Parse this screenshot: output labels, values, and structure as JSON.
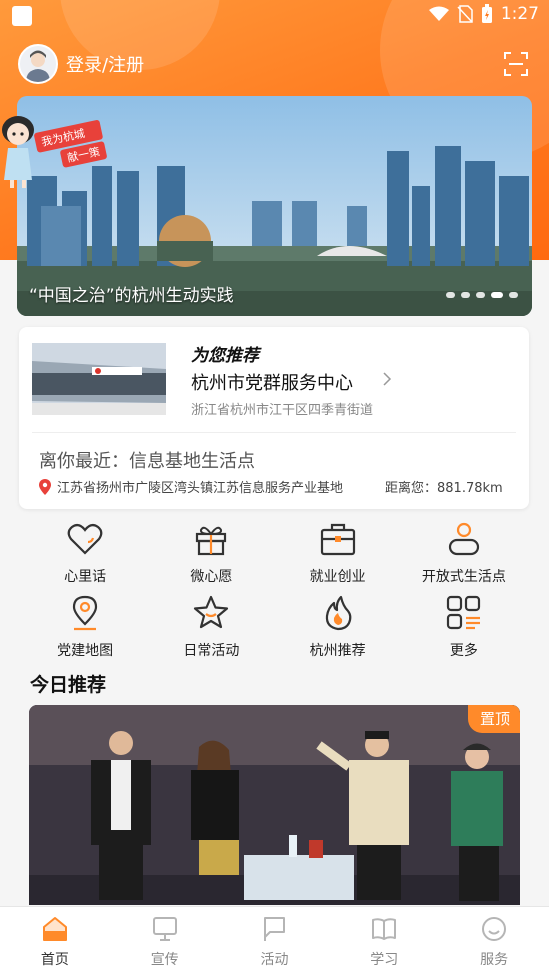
{
  "status_bar": {
    "time": "1:27"
  },
  "header": {
    "login_label": "登录/注册"
  },
  "banner": {
    "caption": "“中国之治”的杭州生动实践",
    "badge_line1": "我为杭城",
    "badge_line2": "献一策"
  },
  "recommend": {
    "heading": "为您推荐",
    "name": "杭州市党群服务中心",
    "address": "浙江省杭州市江干区四季青街道",
    "nearest_title": "离你最近：信息基地生活点",
    "nearest_address": "江苏省扬州市广陵区湾头镇江苏信息服务产业基地",
    "nearest_distance": "距离您：881.78km"
  },
  "menu": [
    {
      "label": "心里话",
      "icon": "heart-chat-icon"
    },
    {
      "label": "微心愿",
      "icon": "gift-icon"
    },
    {
      "label": "就业创业",
      "icon": "briefcase-icon"
    },
    {
      "label": "开放式生活点",
      "icon": "person-icon"
    },
    {
      "label": "党建地图",
      "icon": "map-pin-icon"
    },
    {
      "label": "日常活动",
      "icon": "star-icon"
    },
    {
      "label": "杭州推荐",
      "icon": "flame-icon"
    },
    {
      "label": "更多",
      "icon": "grid-icon"
    }
  ],
  "today": {
    "title": "今日推荐",
    "pin_label": "置顶"
  },
  "bottom_nav": [
    {
      "label": "首页",
      "icon": "home-icon",
      "active": true
    },
    {
      "label": "宣传",
      "icon": "monitor-icon",
      "active": false
    },
    {
      "label": "活动",
      "icon": "flag-icon",
      "active": false
    },
    {
      "label": "学习",
      "icon": "book-icon",
      "active": false
    },
    {
      "label": "服务",
      "icon": "smile-icon",
      "active": false
    }
  ],
  "colors": {
    "accent": "#ff7a1f",
    "icon_orange": "#ff8a2a"
  }
}
